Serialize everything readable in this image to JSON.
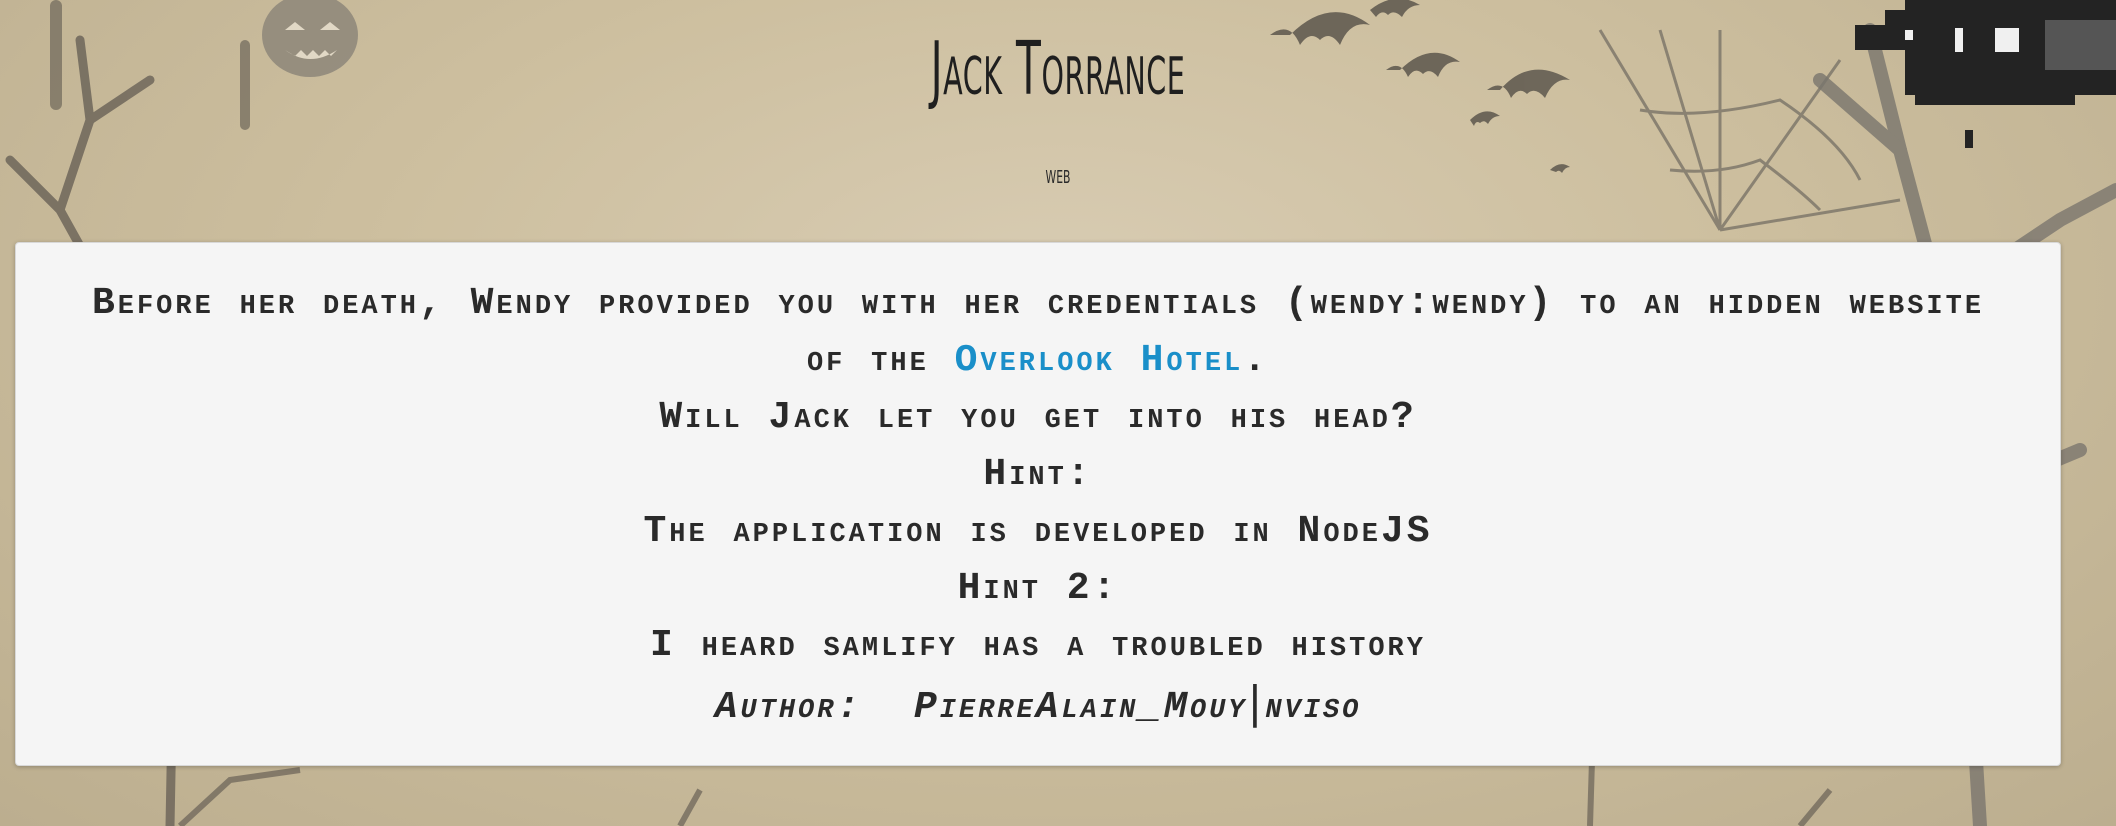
{
  "header": {
    "title": "Jack Torrance",
    "category": "web"
  },
  "challenge": {
    "intro_before_link": "Before her death, Wendy provided you with her credentials (wendy:wendy) to an hidden website of the ",
    "link_text": "Overlook Hotel",
    "intro_after_link": ".",
    "question": "Will Jack let you get into his head?",
    "hint1_label": "Hint:",
    "hint1_text": "The application is developed in NodeJS",
    "hint2_label": "Hint 2:",
    "hint2_text": "I heard samlify has a troubled history",
    "author_label": "Author:",
    "author_name": "PierreAlain_Mouy",
    "author_separator": "|",
    "author_org": "nviso"
  },
  "colors": {
    "link": "#1a8fc9",
    "text": "#2a2a2a",
    "card_bg": "#f5f5f5"
  },
  "icons": {
    "background": "halloween-scene",
    "corner": "pixel-ghost-icon"
  }
}
